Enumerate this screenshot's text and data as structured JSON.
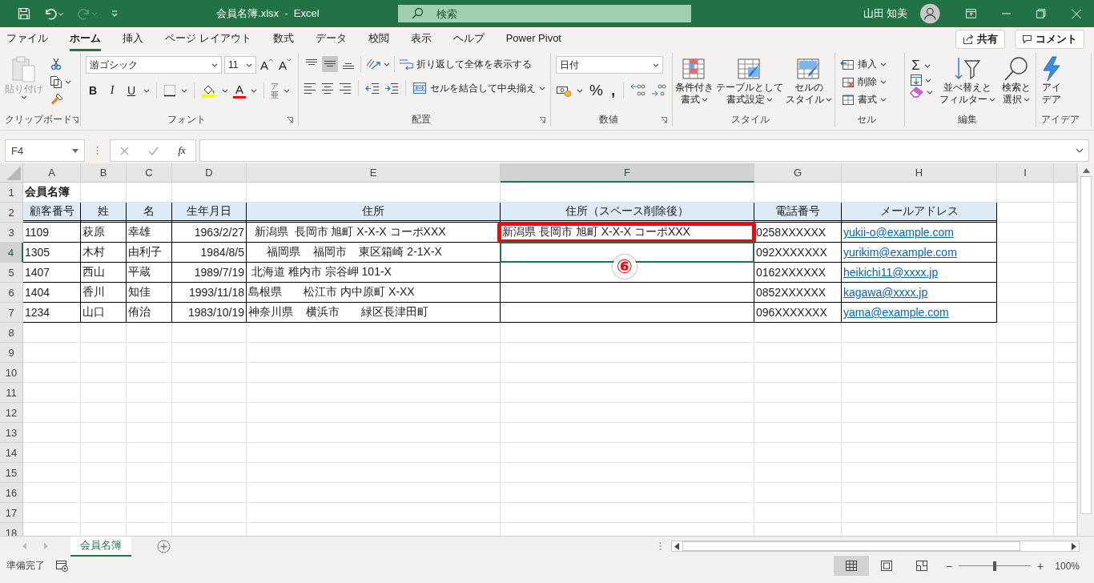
{
  "title_bar": {
    "redo_disabled": true,
    "file_title": "会員名簿.xlsx  -  Excel",
    "search": {
      "placeholder": "検索"
    },
    "user": "山田 知美"
  },
  "menu_tabs": [
    {
      "label": "ファイル",
      "selected": false
    },
    {
      "label": "ホーム",
      "selected": true
    },
    {
      "label": "挿入",
      "selected": false
    },
    {
      "label": "ページ レイアウト",
      "selected": false
    },
    {
      "label": "数式",
      "selected": false
    },
    {
      "label": "データ",
      "selected": false
    },
    {
      "label": "校閲",
      "selected": false
    },
    {
      "label": "表示",
      "selected": false
    },
    {
      "label": "ヘルプ",
      "selected": false
    },
    {
      "label": "Power Pivot",
      "selected": false
    }
  ],
  "share_button": "共有",
  "comment_button": "コメント",
  "ribbon": {
    "clipboard": {
      "paste": "貼り付け",
      "label": "クリップボード"
    },
    "font": {
      "font_name": "游ゴシック",
      "font_size": "11",
      "grow": "A",
      "shrink": "A",
      "styles": [
        "B",
        "I",
        "U"
      ],
      "font_color": "A",
      "phonetic": "ア亜",
      "label": "フォント"
    },
    "alignment": {
      "vertical": [
        {
          "selected": false
        },
        {
          "selected": true
        },
        {
          "selected": false
        }
      ],
      "wrap_text": "折り返して全体を表示する",
      "merge_center": "セルを結合して中央揃え",
      "label": "配置"
    },
    "number": {
      "format": "日付",
      "percent": "%",
      "comma": ",",
      "label": "数値"
    },
    "styles": {
      "buttons": [
        {
          "lines": [
            "条件付き",
            "書式"
          ]
        },
        {
          "lines": [
            "テーブルとして",
            "書式設定"
          ]
        },
        {
          "lines": [
            "セルの",
            "スタイル"
          ]
        }
      ],
      "label": "スタイル"
    },
    "cells": {
      "buttons": [
        "挿入",
        "削除",
        "書式"
      ],
      "label": "セル"
    },
    "editing": {
      "sum": "Σ",
      "buttons": [
        {
          "lines": [
            "並べ替えと",
            "フィルター"
          ]
        },
        {
          "lines": [
            "検索と",
            "選択"
          ]
        }
      ],
      "label": "編集"
    },
    "ideas": {
      "lines": [
        "アイ",
        "デア"
      ],
      "label": "アイデア"
    }
  },
  "formula_bar": {
    "name_box": "F4",
    "fx": "fx"
  },
  "sheet": {
    "columns": [
      {
        "label": "A",
        "selected": false
      },
      {
        "label": "B",
        "selected": false
      },
      {
        "label": "C",
        "selected": false
      },
      {
        "label": "D",
        "selected": false
      },
      {
        "label": "E",
        "selected": false
      },
      {
        "label": "F",
        "selected": true
      },
      {
        "label": "G",
        "selected": false
      },
      {
        "label": "H",
        "selected": false
      },
      {
        "label": "I",
        "selected": false
      }
    ],
    "rows": [
      {
        "number": "1",
        "selected": false,
        "kind": "title",
        "annotated": false,
        "cells": [
          "会員名簿"
        ]
      },
      {
        "number": "2",
        "selected": false,
        "kind": "header",
        "annotated": false,
        "cells": [
          "顧客番号",
          "姓",
          "名",
          "生年月日",
          "住所",
          "住所（スペース削除後）",
          "電話番号",
          "メールアドレス"
        ]
      },
      {
        "number": "3",
        "selected": false,
        "kind": "data",
        "annotated": true,
        "cells": [
          "1109",
          "萩原",
          "幸雄",
          "1963/2/27",
          "  新潟県  長岡市 旭町 X-X-X コーポXXX",
          "新潟県 長岡市 旭町 X-X-X コーポXXX",
          "0258XXXXXX",
          {
            "text": "yukii-o@example.com",
            "kind": "link"
          }
        ]
      },
      {
        "number": "4",
        "selected": true,
        "kind": "data",
        "annotated": false,
        "cells": [
          "1305",
          "木村",
          "由利子",
          "1984/8/5",
          "      福岡県    福岡市    東区箱崎 2-1X-X",
          null,
          "092XXXXXXX",
          {
            "text": "yurikim@example.com",
            "kind": "link"
          }
        ]
      },
      {
        "number": "5",
        "selected": false,
        "kind": "data",
        "annotated": false,
        "cells": [
          "1407",
          "西山",
          "平蔵",
          "1989/7/19",
          " 北海道 稚内市 宗谷岬 101-X",
          null,
          "0162XXXXXX",
          {
            "text": "heikichi11@xxxx.jp",
            "kind": "link"
          }
        ]
      },
      {
        "number": "6",
        "selected": false,
        "kind": "data",
        "annotated": false,
        "cells": [
          "1404",
          "香川",
          "知佳",
          "1993/11/18",
          "島根県       松江市 内中原町 X-XX",
          null,
          "0852XXXXXX",
          {
            "text": "kagawa@xxxx.jp",
            "kind": "link"
          }
        ]
      },
      {
        "number": "7",
        "selected": false,
        "kind": "data",
        "annotated": false,
        "cells": [
          "1234",
          "山口",
          "侑治",
          "1983/10/19",
          "神奈川県    横浜市       緑区長津田町",
          null,
          "096XXXXXXX",
          {
            "text": "yama@example.com",
            "kind": "link"
          }
        ]
      },
      {
        "number": "8",
        "selected": false
      },
      {
        "number": "9",
        "selected": false
      },
      {
        "number": "10",
        "selected": false
      },
      {
        "number": "11",
        "selected": false
      },
      {
        "number": "12",
        "selected": false
      },
      {
        "number": "13",
        "selected": false
      },
      {
        "number": "14",
        "selected": false
      },
      {
        "number": "15",
        "selected": false
      },
      {
        "number": "16",
        "selected": false
      },
      {
        "number": "17",
        "selected": false
      },
      {
        "number": "18",
        "selected": false
      }
    ]
  },
  "annotation": {
    "label": "⑥"
  },
  "sheet_tabs": [
    {
      "label": "会員名簿",
      "selected": true
    }
  ],
  "status_bar": {
    "status": "準備完了",
    "views": [
      {
        "selected": true
      },
      {
        "selected": false
      },
      {
        "selected": false
      }
    ],
    "zoom_out": "−",
    "zoom_in": "+",
    "zoom": {
      "level": 0.5
    },
    "zoom_label": "100%"
  }
}
